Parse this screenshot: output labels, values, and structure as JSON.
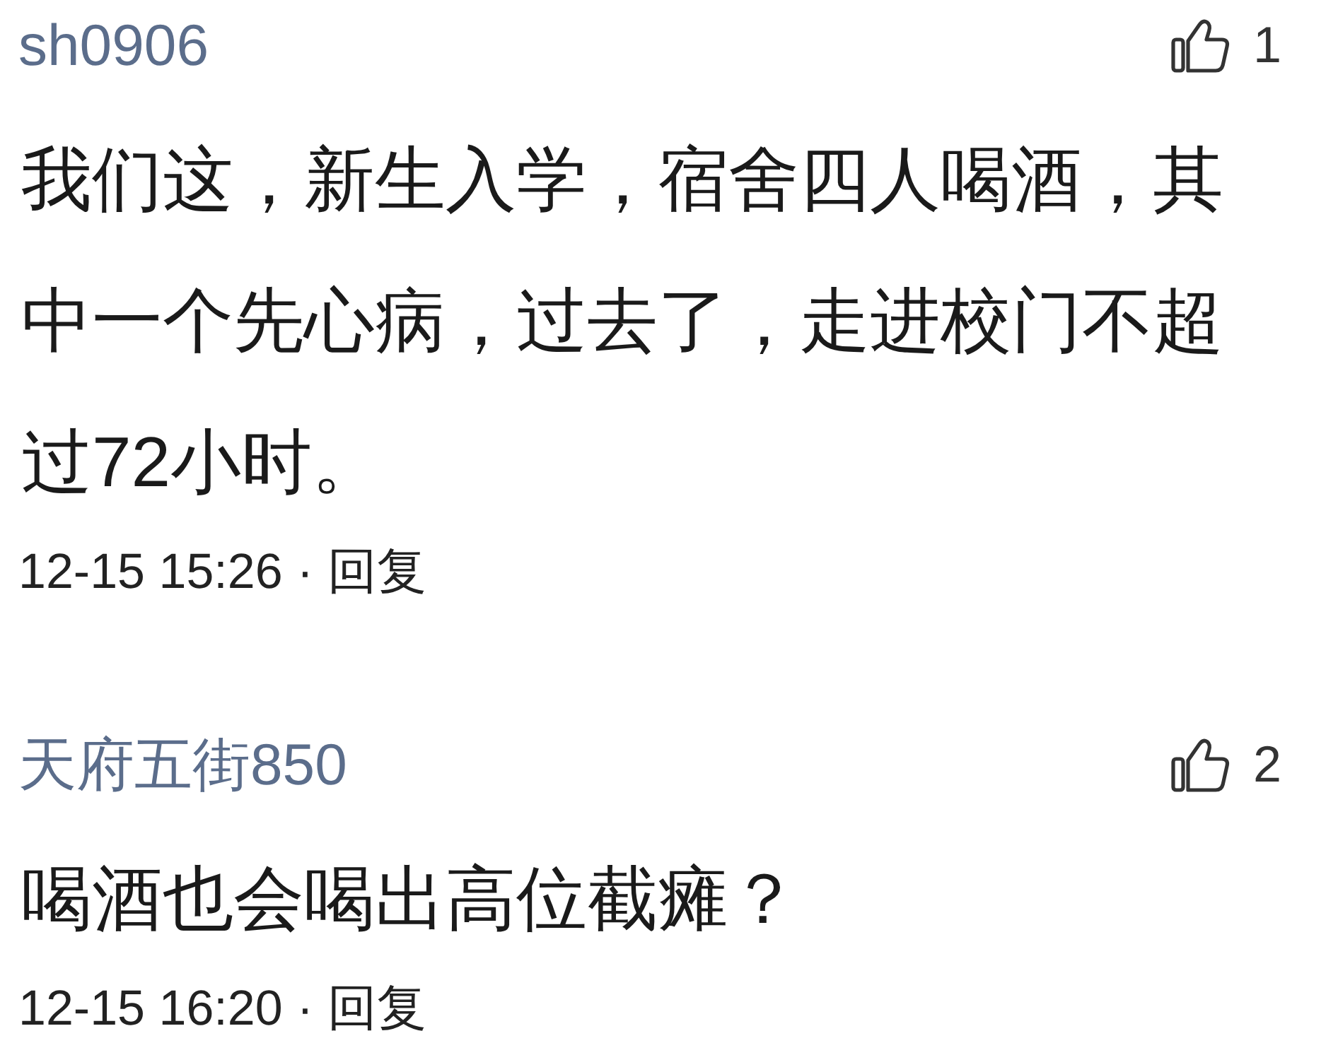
{
  "comments": [
    {
      "username": "sh0906",
      "likes": "1",
      "text": "我们这，新生入学，宿舍四人喝酒，其中一个先心病，过去了，走进校门不超过72小时。",
      "time": "12-15 15:26",
      "separator": "·",
      "reply": "回复"
    },
    {
      "username": "天府五街850",
      "likes": "2",
      "text": "喝酒也会喝出高位截瘫？",
      "time": "12-15 16:20",
      "separator": "·",
      "reply": "回复"
    }
  ]
}
